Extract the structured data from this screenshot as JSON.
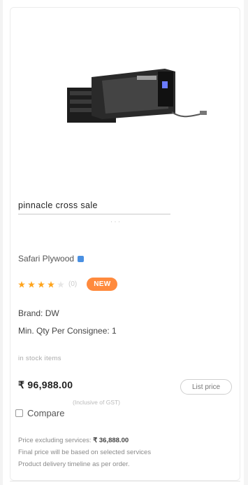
{
  "product": {
    "title": "pinnacle cross sale",
    "title_sub": "· · ·",
    "seller": "Safari Plywood",
    "rating_count": "(0)",
    "badge": "NEW",
    "brand": "Brand: DW",
    "min_qty": "Min. Qty Per Consignee: 1",
    "stock": "in stock items",
    "price": "₹ 96,988.00",
    "list_button": "List price",
    "price_note": "(Inclusive of GST)",
    "compare_label": "Compare",
    "footer": {
      "line1_prefix": "Price excluding services: ",
      "line1_value": "₹ 36,888.00",
      "line2": "Final price will be based on selected services",
      "line3": "Product delivery timeline as per order."
    }
  },
  "icons": {
    "verified": "verified-badge-icon",
    "star": "star-icon",
    "compare": "checkbox-icon"
  },
  "colors": {
    "accent_badge": "#ff8a3d",
    "star": "#ffa41c",
    "verified": "#4a90e2"
  }
}
